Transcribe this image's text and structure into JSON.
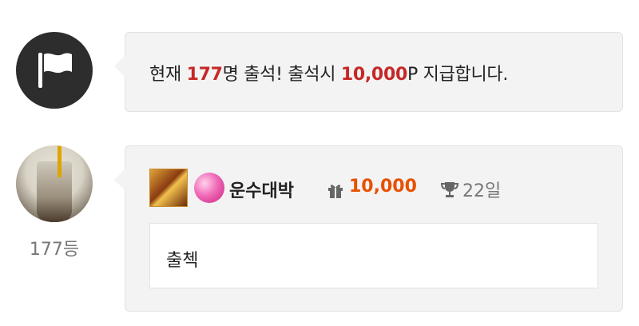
{
  "notice": {
    "prefix": "현재 ",
    "count": "177",
    "mid": "명 출석! 출석시 ",
    "points": "10,000",
    "suffix": "P 지급합니다."
  },
  "entry": {
    "rank_label": "177등",
    "username": "운수대박",
    "points": "10,000",
    "days": "22일",
    "comment": "출첵"
  },
  "colors": {
    "highlight_red": "#c62828",
    "points_orange": "#e65100",
    "bubble_bg": "#f3f3f3"
  },
  "icons": [
    "flag-icon",
    "gift-icon",
    "trophy-icon"
  ]
}
